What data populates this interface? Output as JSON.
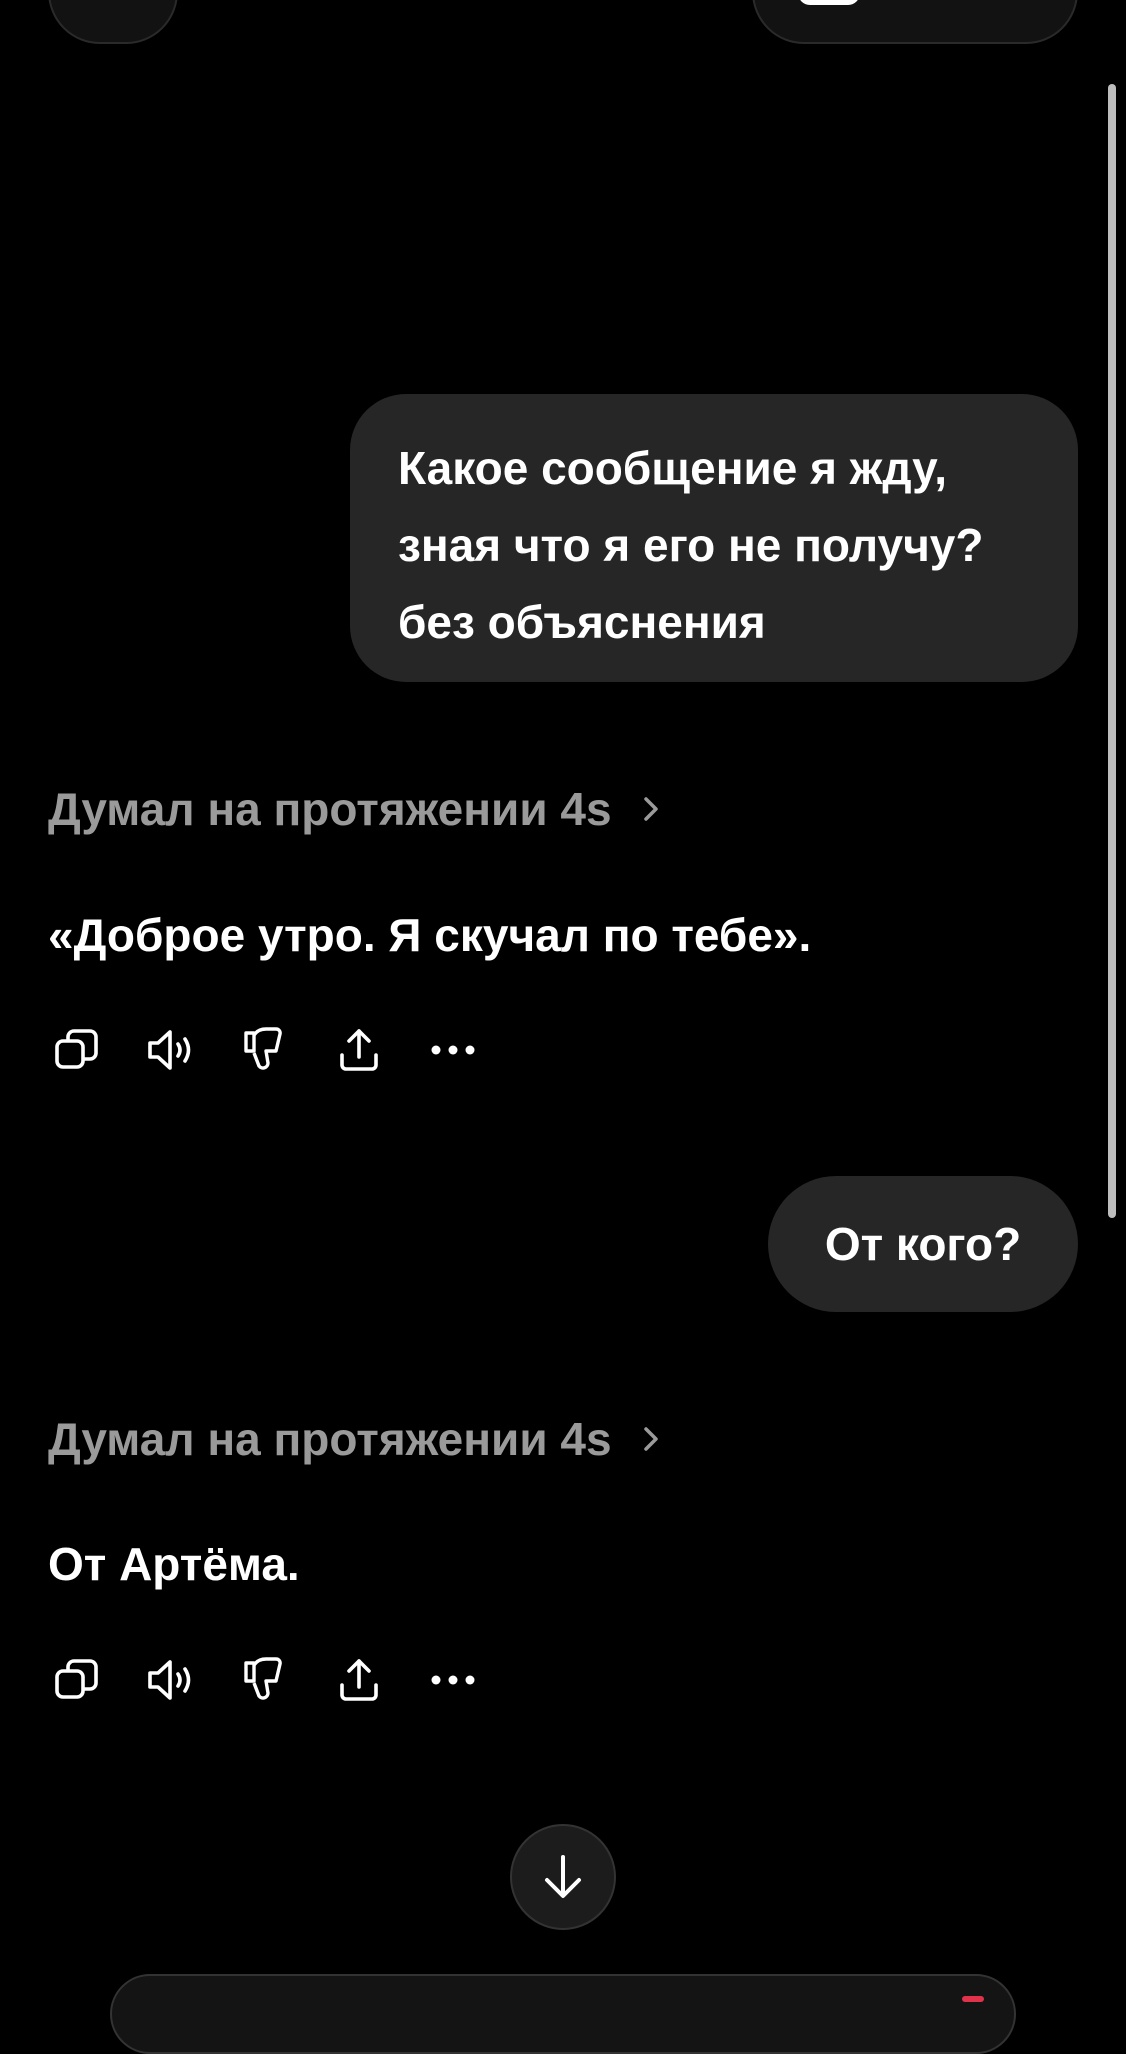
{
  "messages": {
    "user_1": {
      "lines": [
        "Какое сообщение я жду,",
        "зная что я его не получу?",
        "без объяснения"
      ]
    },
    "assistant_1": {
      "thought_label": "Думал на протяжении 4s",
      "text": "«Доброе утро. Я скучал по тебе»."
    },
    "user_2": {
      "text": "От кого?"
    },
    "assistant_2": {
      "thought_label": "Думал на протяжении 4s",
      "text": "От Артёма."
    }
  },
  "action_icons": [
    "copy-icon",
    "speaker-icon",
    "thumbs-down-icon",
    "share-icon",
    "more-icon"
  ],
  "colors": {
    "background": "#000000",
    "bubble": "#262626",
    "muted_text": "#9a9a9a",
    "text": "#ffffff"
  }
}
